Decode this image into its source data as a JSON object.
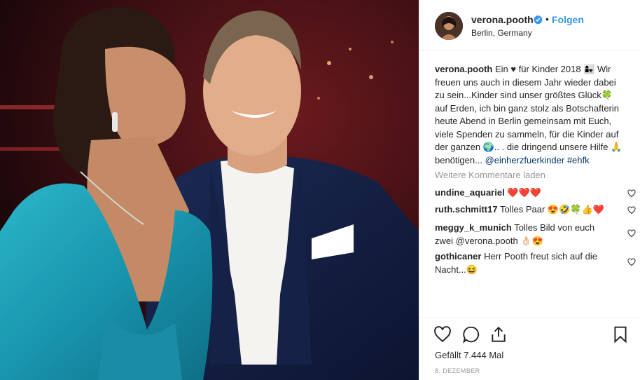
{
  "post": {
    "username": "verona.pooth",
    "follow_label": "Folgen",
    "separator": "•",
    "location": "Berlin, Germany",
    "caption_user": "verona.pooth",
    "caption_text": "Ein ♥ für Kinder 2018 👩‍👧 Wir freuen uns auch in diesem Jahr wieder dabei zu sein...Kinder sind unser größtes Glück🍀 auf Erden, ich bin ganz stolz als Botschafterin heute Abend in Berlin gemeinsam mit Euch, viele Spenden zu sammeln, für die Kinder auf der ganzen 🌍.. . die dringend unsere Hilfe 🙏 benötigen...",
    "caption_tags": "@einherzfuerkinder #ehfk",
    "load_more": "Weitere Kommentare laden",
    "comments": [
      {
        "user": "undine_aquariel",
        "text": "❤️❤️❤️"
      },
      {
        "user": "ruth.schmitt17",
        "text": "Tolles Paar 😍🤣🍀👍❤️"
      },
      {
        "user": "meggy_k_munich",
        "text": "Tolles Bild von euch zwei @verona.pooth 👌🏻😍"
      },
      {
        "user": "gothicaner",
        "text": "Herr Pooth freut sich auf die Nacht...😆"
      }
    ],
    "likes_label": "Gefällt",
    "likes_count": "7.444 Mal",
    "date": "8. DEZEMBER"
  },
  "icons": {
    "like": "heart-outline-icon",
    "comment": "comment-bubble-icon",
    "share": "share-icon",
    "save": "bookmark-icon",
    "verified": "verified-badge-icon",
    "comment_like": "heart-small-icon"
  },
  "colors": {
    "link_blue": "#3897f0",
    "tag_blue": "#003569",
    "muted": "#999999",
    "text": "#262626"
  }
}
